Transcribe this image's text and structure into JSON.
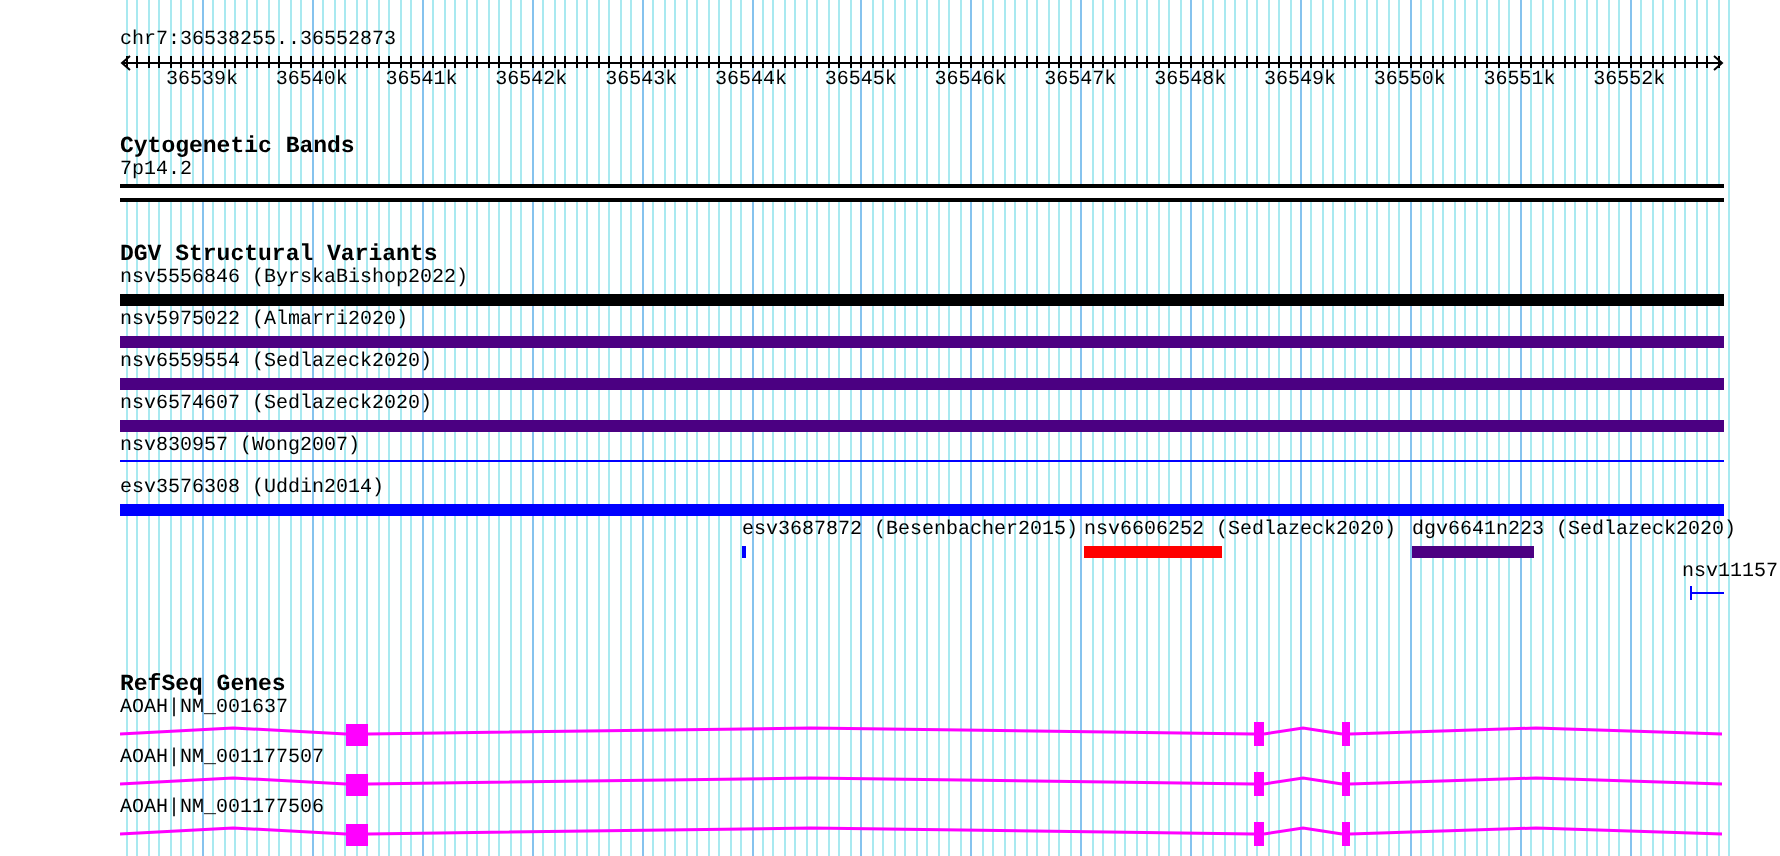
{
  "ruler": {
    "region": "chr7:36538255..36552873",
    "ticks": [
      "36539k",
      "36540k",
      "36541k",
      "36542k",
      "36543k",
      "36544k",
      "36545k",
      "36546k",
      "36547k",
      "36548k",
      "36549k",
      "36550k",
      "36551k",
      "36552k"
    ]
  },
  "cytogenetic_bands": {
    "title": "Cytogenetic Bands",
    "bands": [
      {
        "label": "7p14.2"
      }
    ]
  },
  "dgv_structural_variants": {
    "title": "DGV Structural Variants",
    "rows": [
      {
        "features": [
          {
            "label": "nsv5556846 (ByrskaBishop2022)",
            "kind": "bar",
            "color": "#000000"
          }
        ]
      },
      {
        "features": [
          {
            "label": "nsv5975022 (Almarri2020)",
            "kind": "bar",
            "color": "#4b0082"
          }
        ]
      },
      {
        "features": [
          {
            "label": "nsv6559554 (Sedlazeck2020)",
            "kind": "bar",
            "color": "#4b0082"
          }
        ]
      },
      {
        "features": [
          {
            "label": "nsv6574607 (Sedlazeck2020)",
            "kind": "bar",
            "color": "#4b0082"
          }
        ]
      },
      {
        "features": [
          {
            "label": "nsv830957 (Wong2007)",
            "kind": "line",
            "color": "#0000ff"
          }
        ]
      },
      {
        "features": [
          {
            "label": "esv3576308 (Uddin2014)",
            "kind": "bar",
            "color": "#0000ff"
          }
        ]
      },
      {
        "features": [
          {
            "label": "esv3687872 (Besenbacher2015)",
            "kind": "mark",
            "color": "#0000ff"
          },
          {
            "label": "nsv6606252 (Sedlazeck2020)",
            "kind": "bar",
            "color": "#ff0000"
          },
          {
            "label": "dgv6641n223 (Sedlazeck2020)",
            "kind": "bar",
            "color": "#4b0082"
          }
        ]
      },
      {
        "features": [
          {
            "label": "nsv11157",
            "kind": "capped-line",
            "color": "#0000ff"
          }
        ]
      }
    ]
  },
  "refseq_genes": {
    "title": "RefSeq Genes",
    "genes": [
      {
        "label": "AOAH|NM_001637"
      },
      {
        "label": "AOAH|NM_001177507"
      },
      {
        "label": "AOAH|NM_001177506"
      }
    ]
  }
}
